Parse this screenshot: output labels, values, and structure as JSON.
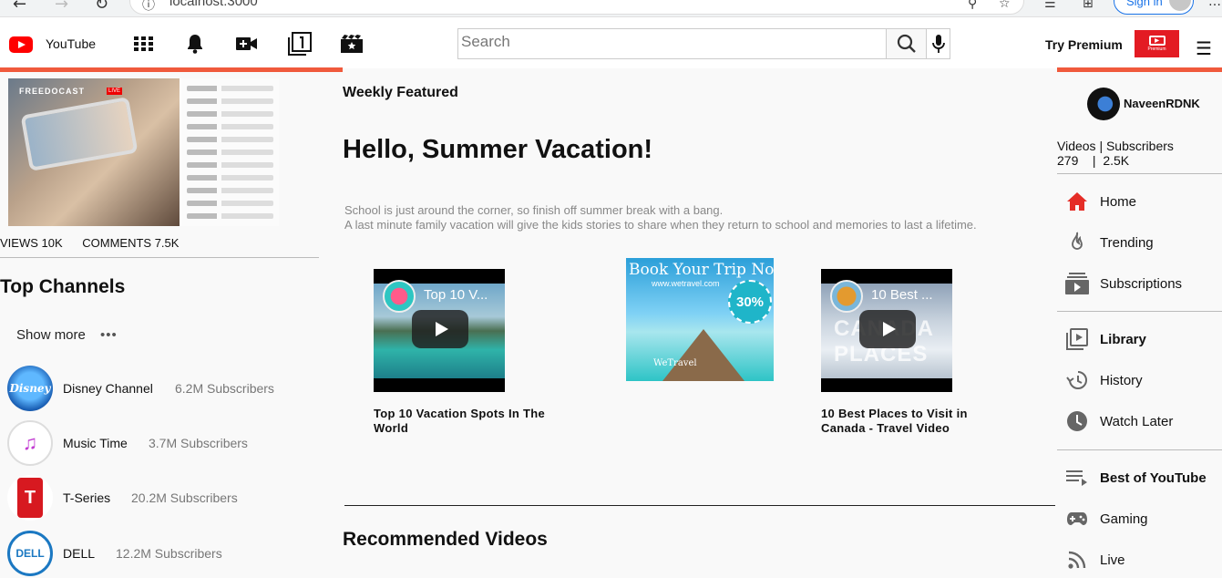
{
  "browser": {
    "url": "localhost:3000",
    "signin_label": "Sign in"
  },
  "header": {
    "app_name": "YouTube",
    "search_placeholder": "Search",
    "premium_label": "Try Premium",
    "premium_badge_text": "Premium",
    "accent_color": "#f05a3c",
    "brand_color": "#ff0000"
  },
  "left": {
    "featured_stats": {
      "views": "VIEWS 10K",
      "comments": "COMMENTS 7.5K"
    },
    "featured_brand": "FREEDOCAST",
    "featured_live": "LIVE",
    "top_channels_title": "Top Channels",
    "show_more_label": "Show more",
    "channels": [
      {
        "name": "Disney Channel",
        "subs": "6.2M Subscribers",
        "logo_text": "Disney"
      },
      {
        "name": "Music Time",
        "subs": "3.7M Subscribers",
        "logo_text": "Music Time"
      },
      {
        "name": "T-Series",
        "subs": "20.2M Subscribers",
        "logo_text": "T"
      },
      {
        "name": "DELL",
        "subs": "12.2M Subscribers",
        "logo_text": "DELL"
      }
    ]
  },
  "main": {
    "section_label": "Weekly Featured",
    "headline": "Hello, Summer Vacation!",
    "description_line1": "School is just around the corner, so finish off summer break with a bang.",
    "description_line2": "A last minute family vacation will give the kids stories to share when they return to school and memories to last a lifetime.",
    "videos": [
      {
        "thumb_title": "Top 10 V...",
        "caption_line1": "Top 10 Vacation Spots In The",
        "caption_line2": "World"
      },
      {
        "thumb_title": "10 Best ...",
        "caption_line1": "10 Best Places to Visit in",
        "caption_line2": "Canada - Travel Video"
      }
    ],
    "ad": {
      "title": "Book Your Trip Now!",
      "sub": "www.wetravel.com",
      "badge": "30%",
      "brand": "WeTravel"
    },
    "recommended_title": "Recommended Videos"
  },
  "right": {
    "username": "NaveenRDNK",
    "stats_labels": "Videos | Subscribers",
    "stats_values": "279    |  2.5K",
    "nav_primary": [
      {
        "label": "Home",
        "icon": "home-icon"
      },
      {
        "label": "Trending",
        "icon": "flame-icon"
      },
      {
        "label": "Subscriptions",
        "icon": "subscriptions-icon"
      }
    ],
    "nav_library": [
      {
        "label": "Library",
        "icon": "library-icon"
      },
      {
        "label": "History",
        "icon": "history-icon"
      },
      {
        "label": "Watch Later",
        "icon": "clock-icon"
      }
    ],
    "nav_best": [
      {
        "label": "Best of YouTube",
        "icon": "playlist-icon"
      },
      {
        "label": "Gaming",
        "icon": "gamepad-icon"
      },
      {
        "label": "Live",
        "icon": "live-icon"
      }
    ]
  }
}
